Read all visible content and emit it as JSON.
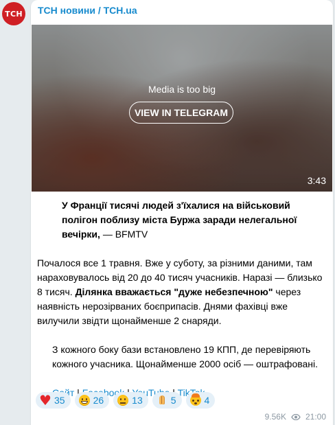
{
  "channel": {
    "avatar_text": "ТСН",
    "name": "ТСН новини / TCH.ua",
    "brand_color": "#cf1f24",
    "link_color": "#168acd"
  },
  "media": {
    "message": "Media is too big",
    "button_label": "VIEW IN TELEGRAM",
    "duration": "3:43"
  },
  "post": {
    "headline_bold": "У Франції тисячі людей з'їхалися на військовий полігон поблизу міста Буржа заради нелегальної вечірки,",
    "headline_source": " — BFMTV",
    "p2_a": "Почалося все 1 травня. Вже у суботу, за різними даними, там нараховувалось від 20 до 40 тисяч учасників. Наразі — близько 8 тисяч. ",
    "p2_bold": "Ділянка вважається \"дуже небезпечною\"",
    "p2_b": " через наявність нерозірваних боєприпасів. Днями фахівці вже вилучили звідти щонайменше 2 снаряди.",
    "p3": "З кожного боку бази встановлено 19 КПП, де перевіряють кожного учасника. Щонайменше 2000 осіб — оштрафовані.",
    "links": [
      "Сайт",
      "Facebook",
      "YouTube",
      "TikTok"
    ],
    "link_separator": " | "
  },
  "reactions": [
    {
      "icon": "red-heart-icon",
      "count": "35"
    },
    {
      "icon": "grinning-face-icon",
      "count": "26"
    },
    {
      "icon": "neutral-face-icon",
      "count": "13"
    },
    {
      "icon": "folded-hands-icon",
      "count": "5"
    },
    {
      "icon": "exploding-head-icon",
      "count": "4"
    }
  ],
  "meta": {
    "views": "9.56K",
    "time": "21:00"
  }
}
